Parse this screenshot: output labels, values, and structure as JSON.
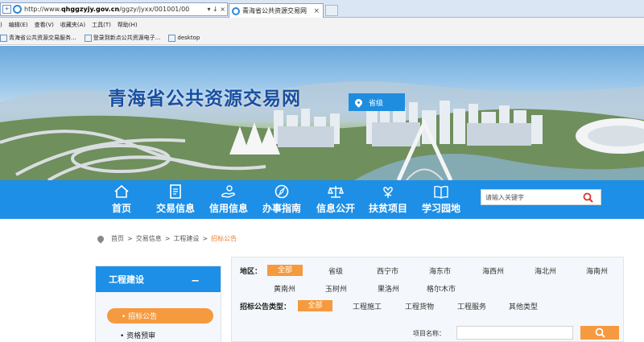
{
  "browser": {
    "url_prefix": "http://www.",
    "url_domain": "qhggzyjy.gov.cn",
    "url_path": "/ggzy/jyxx/001001/00",
    "addr_controls": "▾ ↓ ×",
    "tab_title": "青海省公共资源交易网",
    "tab_close": "×",
    "menu": [
      ")",
      "编辑(E)",
      "查看(V)",
      "收藏夹(A)",
      "工具(T)",
      "帮助(H)"
    ],
    "favorites": [
      "青海省公共资源交易服务...",
      "登录到新点公共资源电子...",
      "desktop"
    ]
  },
  "site": {
    "title": "青海省公共资源交易网",
    "region": "省级"
  },
  "nav": {
    "items": [
      {
        "label": "首页",
        "icon": "home-icon"
      },
      {
        "label": "交易信息",
        "icon": "document-icon"
      },
      {
        "label": "信用信息",
        "icon": "hand-icon"
      },
      {
        "label": "办事指南",
        "icon": "compass-icon"
      },
      {
        "label": "信息公开",
        "icon": "scales-icon"
      },
      {
        "label": "扶贫项目",
        "icon": "heart-hands-icon"
      },
      {
        "label": "学习园地",
        "icon": "book-icon"
      }
    ],
    "search_placeholder": "请输入关键字"
  },
  "breadcrumb": {
    "items": [
      "首页",
      "交易信息",
      "工程建设"
    ],
    "current": "招标公告",
    "sep": ">"
  },
  "sidebar": {
    "title": "工程建设",
    "toggle": "−",
    "items": [
      {
        "label": "• 招标公告",
        "active": true
      },
      {
        "label": "• 资格预审",
        "active": false
      }
    ]
  },
  "filter": {
    "region_label": "地区：",
    "regions_row1": [
      "全部",
      "省级",
      "西宁市",
      "海东市",
      "海西州",
      "海北州",
      "海南州"
    ],
    "regions_row2": [
      "黄南州",
      "玉树州",
      "果洛州",
      "格尔木市"
    ],
    "type_label": "招标公告类型：",
    "types": [
      "全部",
      "工程施工",
      "工程货物",
      "工程服务",
      "其他类型"
    ],
    "name_label": "项目名称："
  },
  "colors": {
    "accent": "#1d8fe6",
    "highlight": "#f59a3f",
    "title": "#1a4fa0"
  }
}
